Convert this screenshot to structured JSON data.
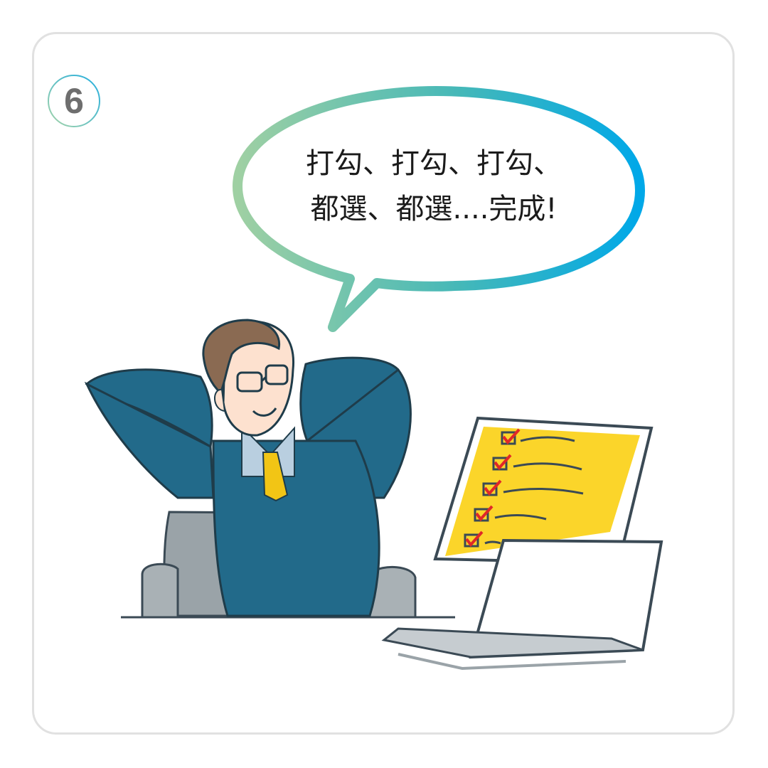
{
  "panel": {
    "number": "6"
  },
  "speech_bubble": {
    "line1": "打勾、打勾、打勾、",
    "line2": "都選、都選....完成!"
  },
  "colors": {
    "bubble_gradient_start": "#9ccea4",
    "bubble_gradient_end": "#00a9e6",
    "checklist_panel": "#fbd52a",
    "check_mark": "#e02828",
    "suit": "#226a8a",
    "tie": "#f2c515",
    "hair": "#8a6a52",
    "chair": "#9aa3a8"
  },
  "icons": {
    "panel_badge": "numbered-circle-icon",
    "checkboxes": "checked-box-icon"
  }
}
